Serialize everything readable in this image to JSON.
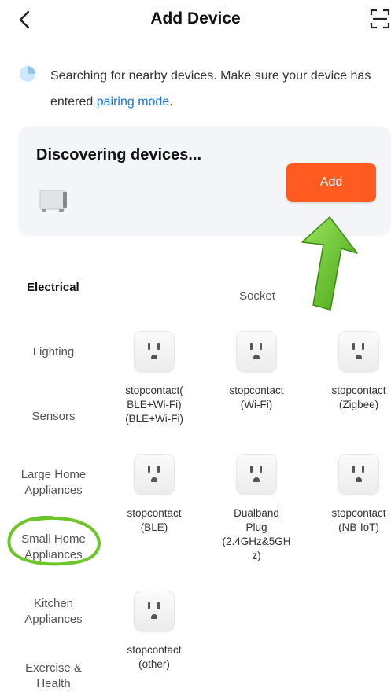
{
  "header": {
    "title": "Add Device",
    "back_icon": "chevron-left-icon",
    "scan_icon": "scan-icon"
  },
  "info": {
    "text_before": "Searching for nearby devices. Make sure your device has entered ",
    "link": "pairing mode",
    "text_after": "."
  },
  "discover": {
    "title": "Discovering devices...",
    "add_label": "Add"
  },
  "sidebar": {
    "items": [
      {
        "label": "Electrical"
      },
      {
        "label": "Lighting"
      },
      {
        "label": "Sensors"
      },
      {
        "label": "Large Home\nAppliances"
      },
      {
        "label": "Small Home\nAppliances"
      },
      {
        "label": "Kitchen\nAppliances"
      },
      {
        "label": "Exercise &\nHealth"
      }
    ]
  },
  "main": {
    "section": "Socket",
    "devices": [
      {
        "name": "stopcontact(\nBLE+Wi-Fi)\n(BLE+Wi-Fi)"
      },
      {
        "name": "stopcontact\n(Wi-Fi)"
      },
      {
        "name": "stopcontact\n(Zigbee)"
      },
      {
        "name": "stopcontact\n(BLE)"
      },
      {
        "name": "Dualband\nPlug\n(2.4GHz&5GH\nz)"
      },
      {
        "name": "stopcontact\n(NB-IoT)"
      },
      {
        "name": "stopcontact\n(other)"
      }
    ]
  },
  "colors": {
    "accent": "#ff5a1f",
    "link": "#1677e5",
    "annotation": "#6dc52a"
  }
}
